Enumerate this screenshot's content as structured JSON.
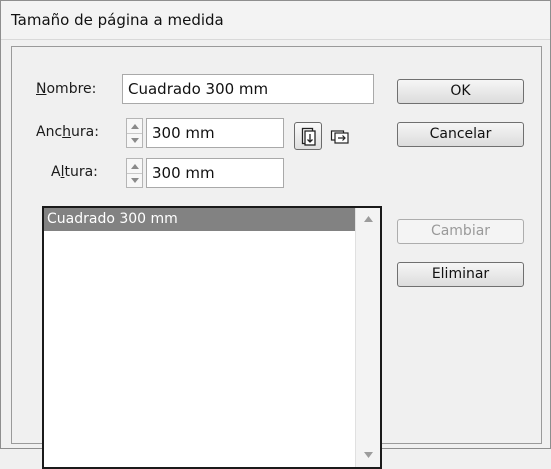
{
  "window": {
    "title": "Tamaño de página a medida"
  },
  "form": {
    "name_label_accel": "N",
    "name_label_rest": "ombre:",
    "name_value": "Cuadrado 300 mm",
    "width_label_pre": "Anc",
    "width_label_accel": "h",
    "width_label_post": "ura:",
    "width_value": "300 mm",
    "height_label_pre": "A",
    "height_label_accel": "l",
    "height_label_post": "tura:",
    "height_value": "300 mm"
  },
  "list": {
    "items": [
      "Cuadrado 300 mm"
    ],
    "selected_index": 0
  },
  "buttons": {
    "ok": "OK",
    "cancel": "Cancelar",
    "change": "Cambiar",
    "delete": "Eliminar"
  },
  "icons": {
    "portrait": "portrait-orientation-icon",
    "landscape": "landscape-orientation-icon"
  }
}
